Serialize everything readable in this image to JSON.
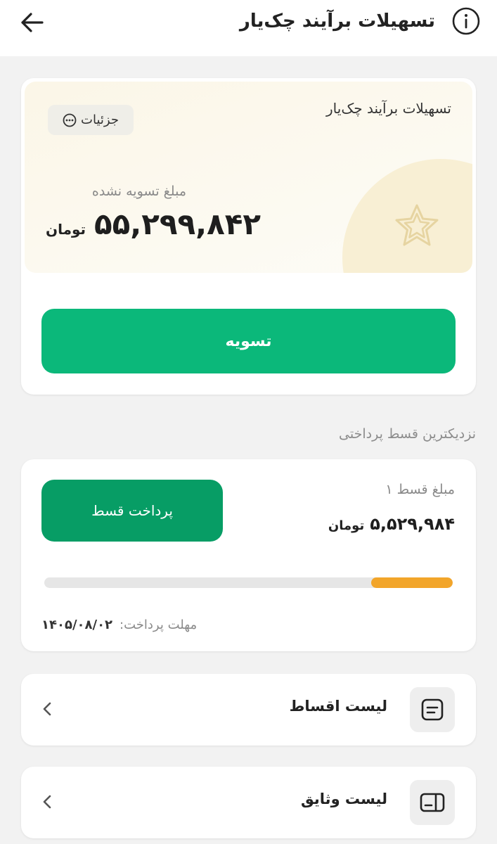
{
  "header": {
    "title": "تسهیلات برآیند چک‌یار"
  },
  "facility_card": {
    "title": "تسهیلات برآیند چک‌یار",
    "details_label": "جزئیات",
    "unsettled_label": "مبلغ تسویه نشده",
    "unsettled_amount": "۵۵,۲۹۹,۸۴۲",
    "currency": "تومان",
    "settle_button": "تسویه"
  },
  "nearest_installment": {
    "section_title": "نزدیکترین قسط پرداختی",
    "label": "مبلغ قسط ۱",
    "amount": "۵,۵۲۹,۹۸۴",
    "currency": "تومان",
    "pay_button": "پرداخت قسط",
    "progress_fraction": 0.2,
    "deadline_label": "مهلت پرداخت:",
    "deadline_value": "۱۴۰۵/۰۸/۰۲"
  },
  "menu": {
    "installments_list": "لیست اقساط",
    "collaterals_list": "لیست وثایق"
  },
  "colors": {
    "primary_green": "#0bb87a",
    "dark_green": "#079d65",
    "progress_orange": "#f2a52a",
    "promo_bg": "#fbf6e7"
  },
  "icons": {
    "back": "arrow-left-icon",
    "info": "info-icon",
    "details": "more-dots-icon",
    "promo": "star-icon",
    "installments": "installments-list-icon",
    "collaterals": "collaterals-list-icon",
    "chevron": "chevron-left-icon"
  }
}
